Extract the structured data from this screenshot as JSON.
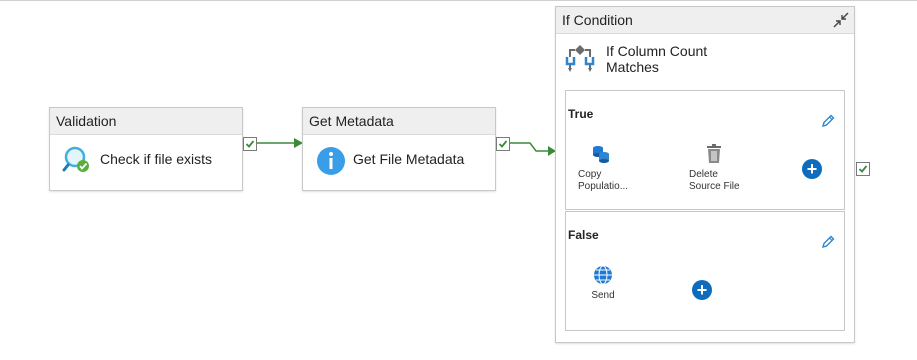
{
  "canvas": {
    "activities": [
      {
        "header": "Validation",
        "name": "Check if file exists",
        "icon": "validation-icon"
      },
      {
        "header": "Get Metadata",
        "name": "Get File Metadata",
        "icon": "info-icon"
      }
    ],
    "if_condition": {
      "header": "If Condition",
      "name": "If Column Count Matches",
      "icon": "if-condition-icon",
      "true_branch": {
        "label": "True",
        "activities": [
          {
            "label": "Copy Populatio...",
            "icon": "copy-data-icon"
          },
          {
            "label": "Delete Source File",
            "icon": "trash-icon"
          }
        ]
      },
      "false_branch": {
        "label": "False",
        "activities": [
          {
            "label": "Send",
            "icon": "web-globe-icon"
          }
        ]
      }
    },
    "plus_symbol": "+",
    "colors": {
      "success_arrow": "#3a8a3a",
      "pending_arrow": "#c8c8c8",
      "accent": "#0f6cbd"
    }
  }
}
